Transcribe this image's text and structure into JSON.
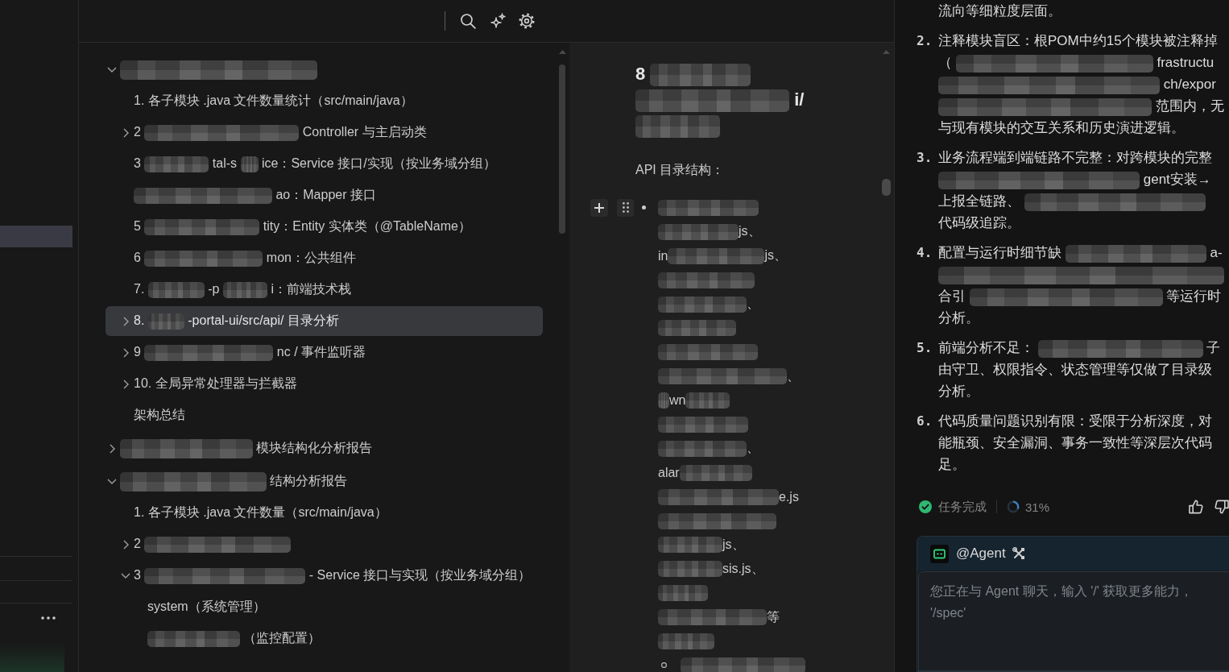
{
  "sidebar": {
    "items": [
      {
        "selected": true
      }
    ]
  },
  "outline": {
    "items": [
      {
        "segments": [
          {
            "kind": "redacted"
          }
        ],
        "expanded": true,
        "selected": false,
        "children": [
          {
            "segments": [
              {
                "kind": "text",
                "text": "1. 各子模块 .java 文件数量统计（src/main/java）"
              }
            ],
            "selected": false
          },
          {
            "segments": [
              {
                "kind": "text",
                "text": "2"
              },
              {
                "kind": "redacted"
              },
              {
                "kind": "text",
                "text": "Controller 与主启动类"
              }
            ],
            "expanded": false,
            "selected": false
          },
          {
            "segments": [
              {
                "kind": "text",
                "text": "3"
              },
              {
                "kind": "redacted"
              },
              {
                "kind": "text",
                "text": "tal-s"
              },
              {
                "kind": "redacted"
              },
              {
                "kind": "text",
                "text": "ice：Service 接口/实现（按业务域分组）"
              }
            ],
            "selected": false
          },
          {
            "segments": [
              {
                "kind": "redacted"
              },
              {
                "kind": "text",
                "text": "ao：Mapper 接口"
              }
            ],
            "selected": false
          },
          {
            "segments": [
              {
                "kind": "text",
                "text": "5"
              },
              {
                "kind": "redacted"
              },
              {
                "kind": "text",
                "text": "tity：Entity 实体类（@TableName）"
              }
            ],
            "selected": false
          },
          {
            "segments": [
              {
                "kind": "text",
                "text": "6"
              },
              {
                "kind": "redacted"
              },
              {
                "kind": "text",
                "text": "mon：公共组件"
              }
            ],
            "selected": false
          },
          {
            "segments": [
              {
                "kind": "text",
                "text": "7."
              },
              {
                "kind": "redacted"
              },
              {
                "kind": "text",
                "text": "-p"
              },
              {
                "kind": "redacted"
              },
              {
                "kind": "text",
                "text": "i：前端技术栈"
              }
            ],
            "selected": false
          },
          {
            "segments": [
              {
                "kind": "text",
                "text": "8."
              },
              {
                "kind": "redacted"
              },
              {
                "kind": "text",
                "text": "-portal-ui/src/api/ 目录分析"
              }
            ],
            "expanded": false,
            "selected": true
          },
          {
            "segments": [
              {
                "kind": "text",
                "text": "9"
              },
              {
                "kind": "redacted"
              },
              {
                "kind": "text",
                "text": "nc / 事件监听器"
              }
            ],
            "expanded": false,
            "selected": false
          },
          {
            "segments": [
              {
                "kind": "text",
                "text": "10. 全局异常处理器与拦截器"
              }
            ],
            "expanded": false,
            "selected": false
          },
          {
            "segments": [
              {
                "kind": "text",
                "text": "架构总结"
              }
            ],
            "selected": false
          }
        ]
      },
      {
        "segments": [
          {
            "kind": "redacted"
          },
          {
            "kind": "text",
            "text": "模块结构化分析报告"
          }
        ],
        "expanded": false,
        "selected": false
      },
      {
        "segments": [
          {
            "kind": "redacted"
          },
          {
            "kind": "text",
            "text": "结构分析报告"
          }
        ],
        "expanded": true,
        "selected": false,
        "children": [
          {
            "segments": [
              {
                "kind": "text",
                "text": "1. 各子模块 .java 文件数量（src/main/java）"
              }
            ],
            "selected": false
          },
          {
            "segments": [
              {
                "kind": "text",
                "text": "2"
              },
              {
                "kind": "redacted"
              }
            ],
            "expanded": false,
            "selected": false
          },
          {
            "segments": [
              {
                "kind": "text",
                "text": "3"
              },
              {
                "kind": "redacted"
              },
              {
                "kind": "text",
                "text": "- Service 接口与实现（按业务域分组）"
              }
            ],
            "expanded": true,
            "selected": false,
            "children": [
              {
                "segments": [
                  {
                    "kind": "text",
                    "text": "system（系统管理）"
                  }
                ],
                "selected": false
              },
              {
                "segments": [
                  {
                    "kind": "redacted"
                  },
                  {
                    "kind": "text",
                    "text": "（监控配置）"
                  }
                ],
                "selected": false
              }
            ]
          }
        ]
      }
    ]
  },
  "document": {
    "heading": {
      "lines": [
        {
          "segments": [
            {
              "kind": "text",
              "text": "8"
            },
            {
              "kind": "redacted"
            }
          ]
        },
        {
          "segments": [
            {
              "kind": "redacted"
            },
            {
              "kind": "text",
              "text": "i/"
            }
          ]
        },
        {
          "segments": [
            {
              "kind": "redacted"
            }
          ]
        }
      ]
    },
    "paragraph": "API 目录结构：",
    "list": [
      {
        "kind": "bullet",
        "segments": [
          {
            "kind": "redacted"
          }
        ]
      },
      {
        "kind": "continuation",
        "segments": [
          {
            "kind": "redacted"
          },
          {
            "kind": "text",
            "text": "js、"
          }
        ]
      },
      {
        "kind": "continuation",
        "segments": [
          {
            "kind": "text",
            "text": "in"
          },
          {
            "kind": "redacted"
          },
          {
            "kind": "text",
            "text": "js、"
          }
        ]
      },
      {
        "kind": "continuation",
        "segments": [
          {
            "kind": "redacted"
          }
        ]
      },
      {
        "kind": "continuation",
        "segments": [
          {
            "kind": "redacted"
          },
          {
            "kind": "text",
            "text": "、"
          }
        ]
      },
      {
        "kind": "continuation",
        "segments": [
          {
            "kind": "redacted"
          }
        ]
      },
      {
        "kind": "continuation",
        "segments": [
          {
            "kind": "redacted"
          }
        ]
      },
      {
        "kind": "continuation",
        "segments": [
          {
            "kind": "redacted"
          },
          {
            "kind": "text",
            "text": "、"
          }
        ]
      },
      {
        "kind": "continuation",
        "segments": [
          {
            "kind": "redacted"
          },
          {
            "kind": "text",
            "text": "wn"
          },
          {
            "kind": "redacted"
          }
        ]
      },
      {
        "kind": "continuation",
        "segments": [
          {
            "kind": "redacted"
          }
        ]
      },
      {
        "kind": "continuation",
        "segments": [
          {
            "kind": "redacted"
          },
          {
            "kind": "text",
            "text": "、"
          }
        ]
      },
      {
        "kind": "continuation",
        "segments": [
          {
            "kind": "text",
            "text": "alar"
          },
          {
            "kind": "redacted"
          }
        ]
      },
      {
        "kind": "continuation",
        "segments": [
          {
            "kind": "redacted"
          },
          {
            "kind": "text",
            "text": "e.js"
          }
        ]
      },
      {
        "kind": "continuation",
        "segments": [
          {
            "kind": "redacted"
          }
        ]
      },
      {
        "kind": "continuation",
        "segments": [
          {
            "kind": "redacted"
          },
          {
            "kind": "text",
            "text": "js、"
          }
        ]
      },
      {
        "kind": "continuation",
        "segments": [
          {
            "kind": "redacted"
          },
          {
            "kind": "text",
            "text": "sis.js、"
          }
        ]
      },
      {
        "kind": "continuation",
        "segments": [
          {
            "kind": "redacted"
          }
        ]
      },
      {
        "kind": "continuation",
        "segments": [
          {
            "kind": "redacted"
          },
          {
            "kind": "text",
            "text": "等"
          }
        ]
      },
      {
        "kind": "continuation",
        "segments": [
          {
            "kind": "redacted"
          }
        ]
      },
      {
        "kind": "sub_bullet",
        "segments": [
          {
            "kind": "redacted"
          }
        ]
      }
    ]
  },
  "answer": {
    "items": [
      {
        "lines": [
          {
            "segments": [
              {
                "kind": "text",
                "text": "流向等细粒度层面。"
              }
            ]
          }
        ]
      },
      {
        "number": "2.",
        "lines": [
          {
            "segments": [
              {
                "kind": "text",
                "text": "注释模块盲区：根POM中约15个模块被注释掉"
              }
            ]
          },
          {
            "segments": [
              {
                "kind": "text",
                "text": "（"
              },
              {
                "kind": "redacted"
              },
              {
                "kind": "text",
                "text": "frastructu"
              }
            ]
          },
          {
            "segments": [
              {
                "kind": "redacted"
              },
              {
                "kind": "text",
                "text": "ch/expor"
              }
            ]
          },
          {
            "segments": [
              {
                "kind": "redacted"
              },
              {
                "kind": "text",
                "text": "范围内，无"
              }
            ]
          },
          {
            "segments": [
              {
                "kind": "text",
                "text": "与现有模块的交互关系和历史演进逻辑。"
              }
            ]
          }
        ]
      },
      {
        "number": "3.",
        "lines": [
          {
            "segments": [
              {
                "kind": "text",
                "text": "业务流程端到端链路不完整：对跨模块的完整"
              }
            ]
          },
          {
            "segments": [
              {
                "kind": "redacted"
              },
              {
                "kind": "text",
                "text": "gent安装→"
              }
            ]
          },
          {
            "segments": [
              {
                "kind": "text",
                "text": "上报全链路、"
              },
              {
                "kind": "redacted"
              }
            ]
          },
          {
            "segments": [
              {
                "kind": "text",
                "text": "代码级追踪。"
              }
            ]
          }
        ]
      },
      {
        "number": "4.",
        "lines": [
          {
            "segments": [
              {
                "kind": "text",
                "text": "配置与运行时细节缺"
              },
              {
                "kind": "redacted"
              },
              {
                "kind": "text",
                "text": "a-"
              }
            ]
          },
          {
            "segments": [
              {
                "kind": "redacted"
              }
            ]
          },
          {
            "segments": [
              {
                "kind": "text",
                "text": "合引"
              },
              {
                "kind": "redacted"
              },
              {
                "kind": "text",
                "text": "等运行时"
              }
            ]
          },
          {
            "segments": [
              {
                "kind": "text",
                "text": "分析。"
              }
            ]
          }
        ]
      },
      {
        "number": "5.",
        "lines": [
          {
            "segments": [
              {
                "kind": "text",
                "text": "前端分析不足："
              },
              {
                "kind": "redacted"
              },
              {
                "kind": "text",
                "text": "子"
              }
            ]
          },
          {
            "segments": [
              {
                "kind": "text",
                "text": "由守卫、权限指令、状态管理等仅做了目录级"
              }
            ]
          },
          {
            "segments": [
              {
                "kind": "text",
                "text": "分析。"
              }
            ]
          }
        ]
      },
      {
        "number": "6.",
        "lines": [
          {
            "segments": [
              {
                "kind": "text",
                "text": "代码质量问题识别有限：受限于分析深度，对"
              }
            ]
          },
          {
            "segments": [
              {
                "kind": "text",
                "text": "能瓶颈、安全漏洞、事务一致性等深层次代码"
              }
            ]
          },
          {
            "segments": [
              {
                "kind": "text",
                "text": "足。"
              }
            ]
          }
        ]
      }
    ]
  },
  "status": {
    "label": "任务完成",
    "progress": {
      "level": 0.31,
      "reading": "31%"
    }
  },
  "chat": {
    "mention": "@Agent",
    "placeholder": "您正在与 Agent 聊天，输入 '/' 获取更多能力，\n'/spec'"
  }
}
